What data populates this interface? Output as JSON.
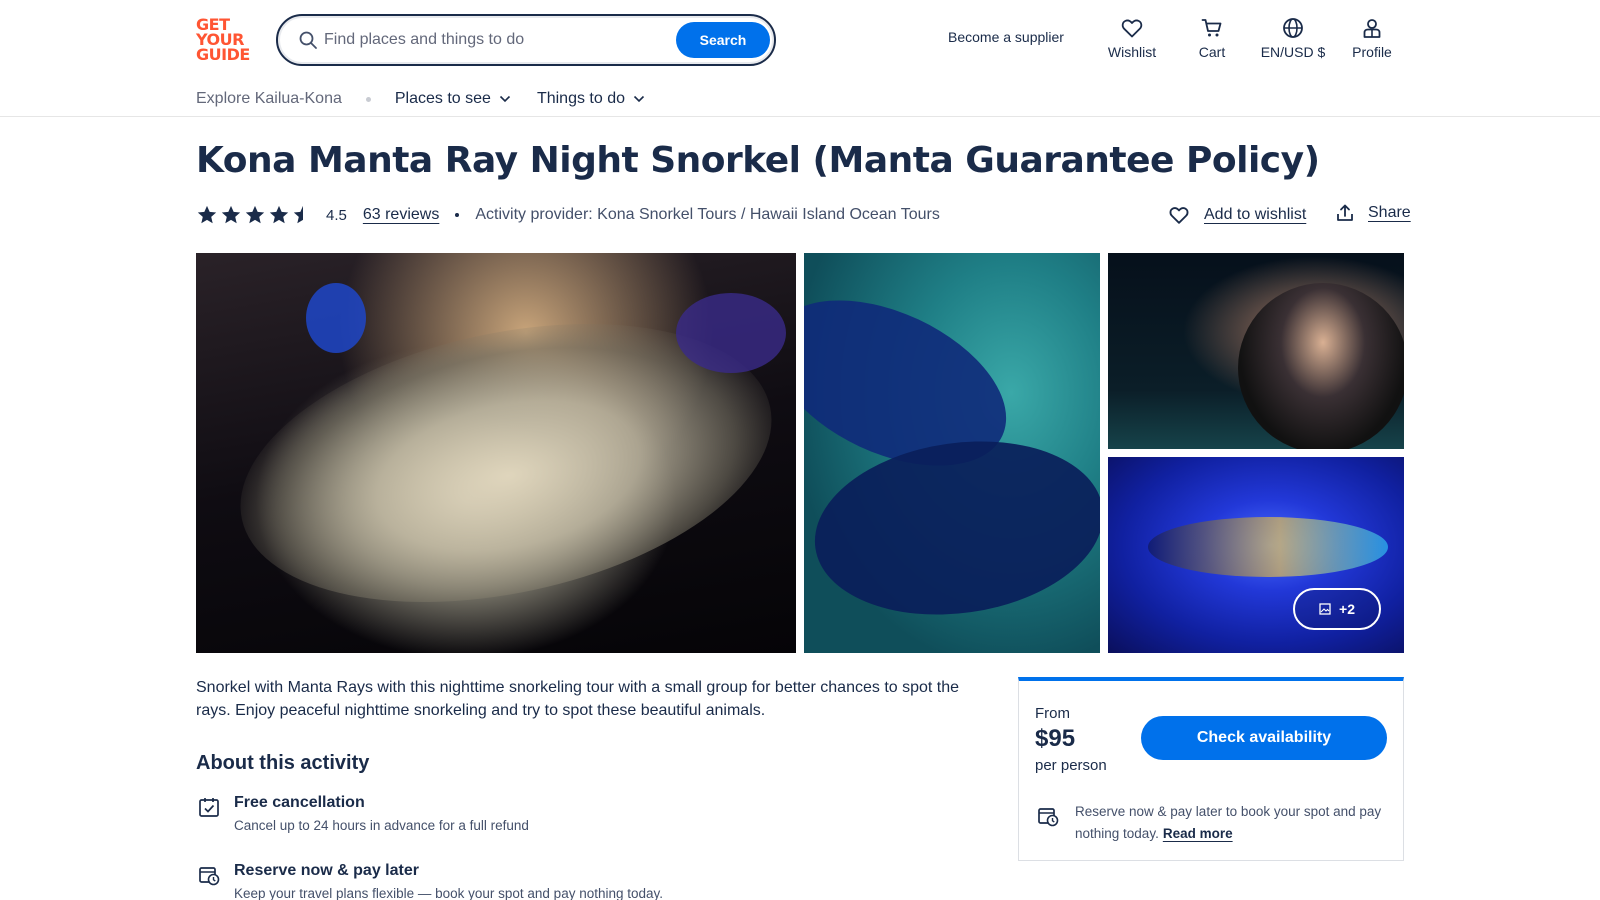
{
  "brand": {
    "logo_lines": [
      "GET",
      "YOUR",
      "GUIDE"
    ],
    "accent": "#ff5533",
    "primary": "#0071eb"
  },
  "search": {
    "placeholder": "Find places and things to do",
    "button_label": "Search"
  },
  "header": {
    "supplier_link": "Become a supplier",
    "nav": [
      {
        "label": "Wishlist",
        "icon": "heart-icon"
      },
      {
        "label": "Cart",
        "icon": "cart-icon"
      },
      {
        "label": "EN/USD $",
        "icon": "globe-icon"
      },
      {
        "label": "Profile",
        "icon": "profile-icon"
      }
    ]
  },
  "subnav": {
    "explore": "Explore Kailua-Kona",
    "items": [
      {
        "label": "Places to see"
      },
      {
        "label": "Things to do"
      }
    ]
  },
  "activity": {
    "title": "Kona Manta Ray Night Snorkel (Manta Guarantee Policy)",
    "rating": "4.5",
    "rating_value": 4.5,
    "reviews": "63 reviews",
    "provider": "Activity provider: Kona Snorkel Tours / Hawaii Island Ocean Tours",
    "wishlist_label": "Add to wishlist",
    "share_label": "Share"
  },
  "gallery": {
    "more_label": "+2"
  },
  "description": "Snorkel with Manta Rays with this nighttime snorkeling tour with a small group for better chances to spot the rays. Enjoy peaceful nighttime snorkeling and try to spot these beautiful animals.",
  "about": {
    "title": "About this activity",
    "features": [
      {
        "title": "Free cancellation",
        "desc": "Cancel up to 24 hours in advance for a full refund",
        "icon": "calendar-check-icon"
      },
      {
        "title": "Reserve now & pay later",
        "desc": "Keep your travel plans flexible — book your spot and pay nothing today.",
        "icon": "calendar-clock-icon"
      }
    ]
  },
  "booking": {
    "from": "From",
    "price": "$95",
    "per": "per person",
    "button": "Check availability",
    "note": "Reserve now & pay later to book your spot and pay nothing today.",
    "read_more": "Read more"
  }
}
